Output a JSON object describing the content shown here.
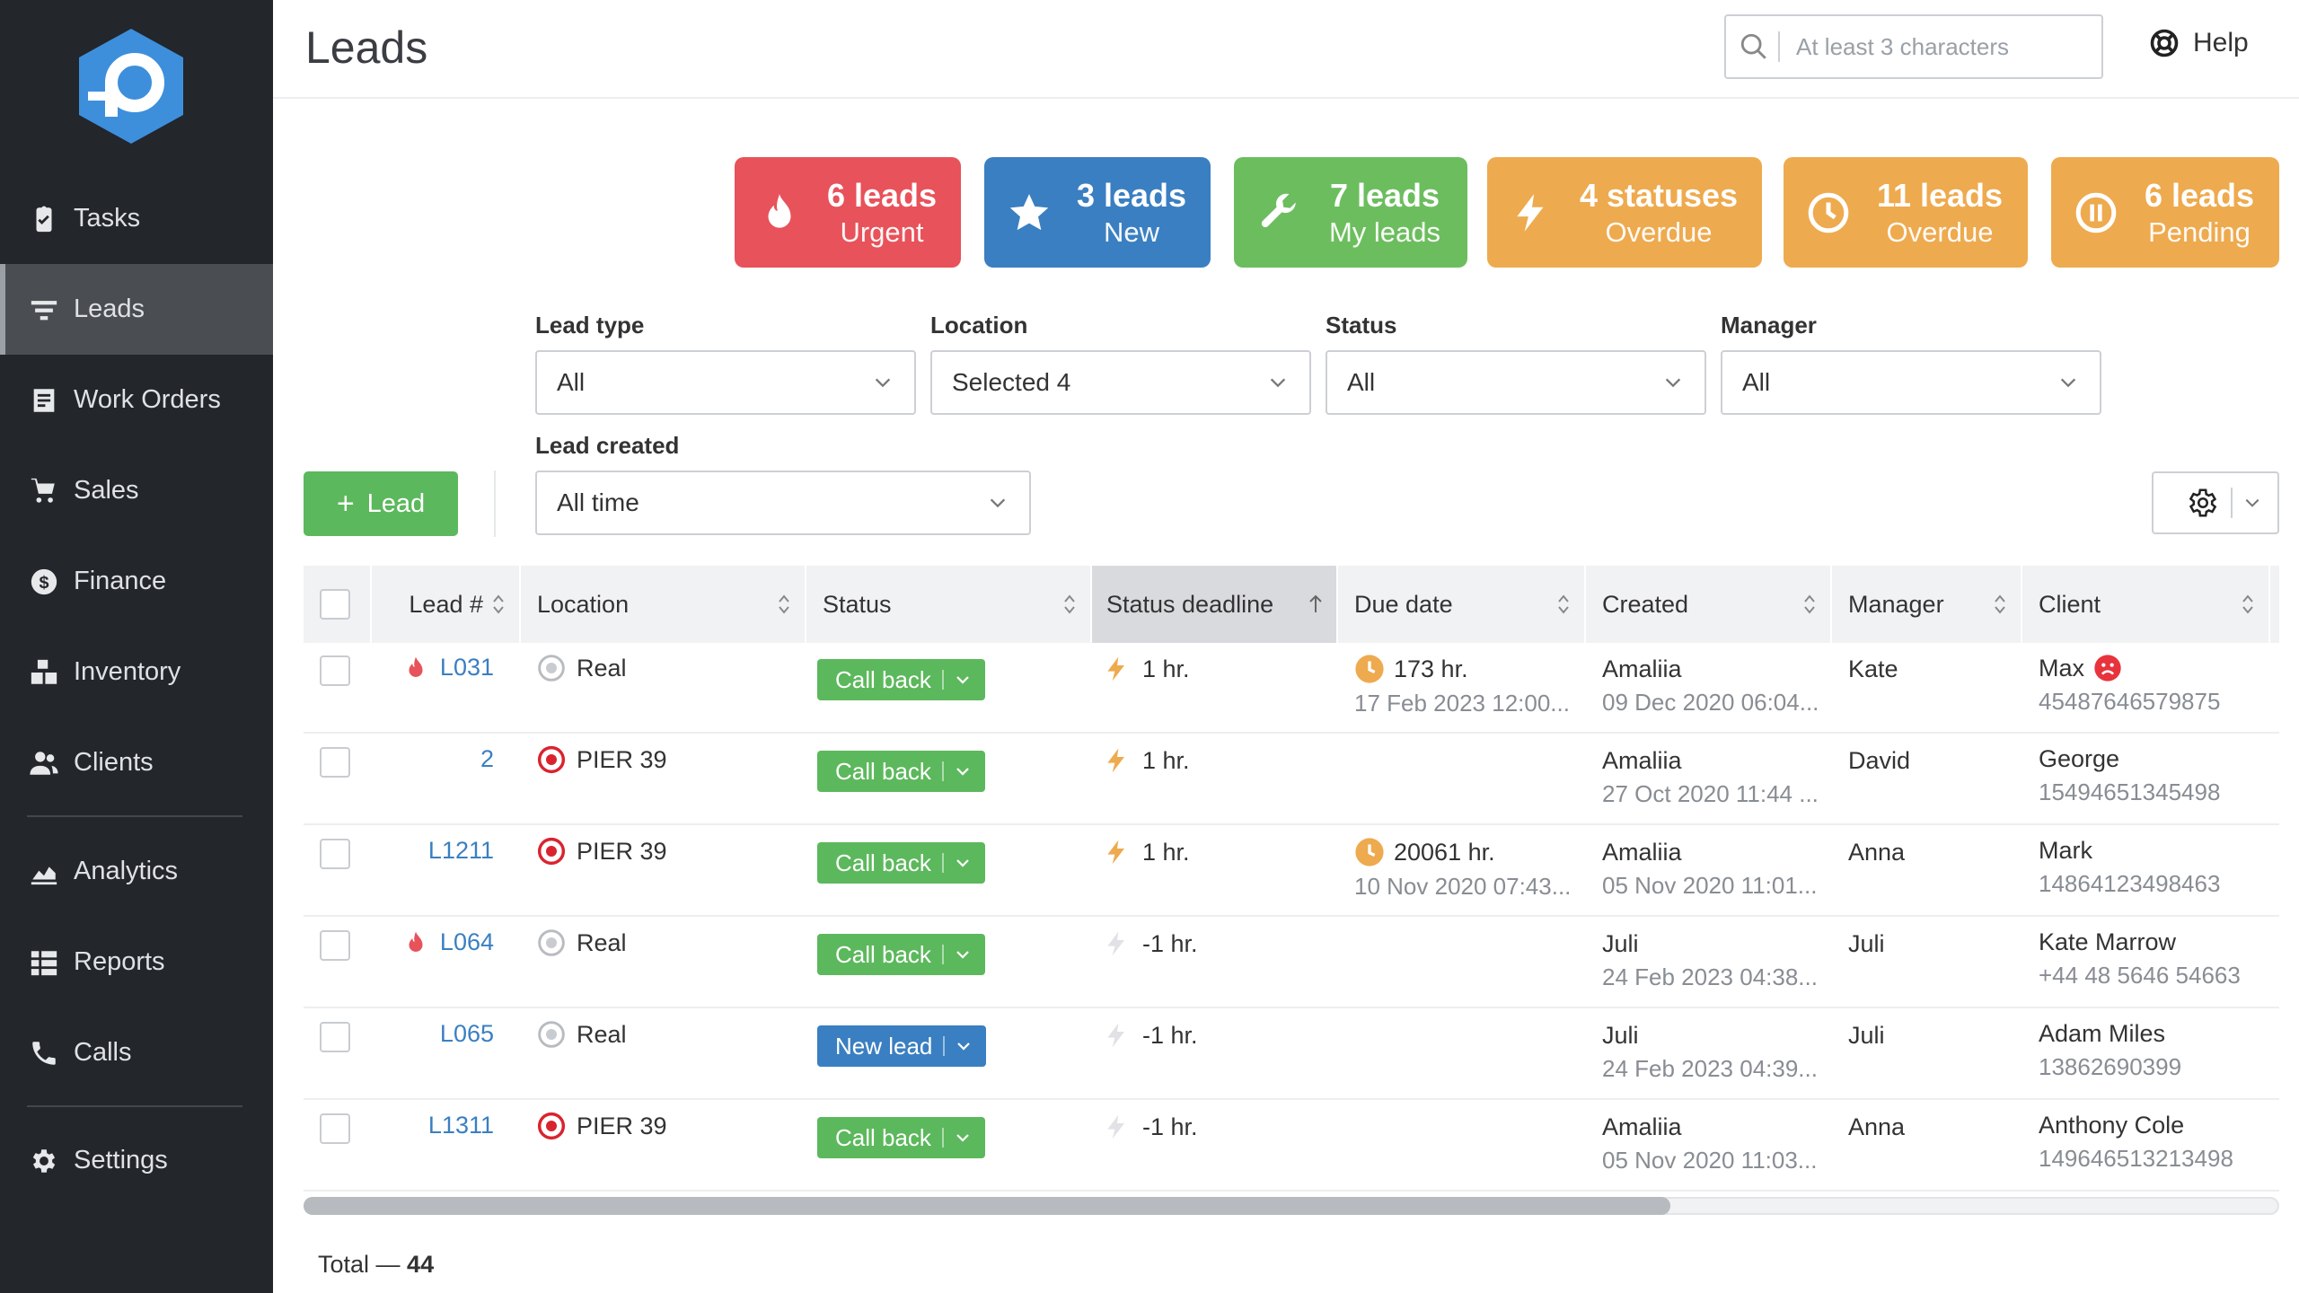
{
  "sidebar": {
    "items": [
      {
        "label": "Tasks",
        "icon": "clipboard-check-icon"
      },
      {
        "label": "Leads",
        "icon": "filter-icon",
        "active": true
      },
      {
        "label": "Work Orders",
        "icon": "document-icon"
      },
      {
        "label": "Sales",
        "icon": "cart-icon"
      },
      {
        "label": "Finance",
        "icon": "dollar-icon"
      },
      {
        "label": "Inventory",
        "icon": "boxes-icon"
      },
      {
        "label": "Clients",
        "icon": "users-icon"
      },
      {
        "label": "Analytics",
        "icon": "chart-icon"
      },
      {
        "label": "Reports",
        "icon": "reports-icon"
      },
      {
        "label": "Calls",
        "icon": "phone-icon"
      },
      {
        "label": "Settings",
        "icon": "gear-icon"
      }
    ]
  },
  "header": {
    "title": "Leads",
    "search_placeholder": "At least 3 characters",
    "help_label": "Help"
  },
  "summary_cards": [
    {
      "big": "6 leads",
      "small": "Urgent",
      "color": "#e8525a",
      "icon": "flame-icon"
    },
    {
      "big": "3 leads",
      "small": "New",
      "color": "#3a7fc1",
      "icon": "star-icon"
    },
    {
      "big": "7 leads",
      "small": "My leads",
      "color": "#6cbd5e",
      "icon": "wrench-icon"
    },
    {
      "big": "4 statuses",
      "small": "Overdue",
      "color": "#eeaa4e",
      "icon": "lightning-icon"
    },
    {
      "big": "11 leads",
      "small": "Overdue",
      "color": "#eeaa4e",
      "icon": "clock-icon"
    },
    {
      "big": "6 leads",
      "small": "Pending",
      "color": "#eeaa4e",
      "icon": "pause-icon"
    }
  ],
  "filters": {
    "lead_type": {
      "label": "Lead type",
      "value": "All"
    },
    "location": {
      "label": "Location",
      "value": "Selected 4"
    },
    "status": {
      "label": "Status",
      "value": "All"
    },
    "manager": {
      "label": "Manager",
      "value": "All"
    },
    "lead_created": {
      "label": "Lead created",
      "value": "All time"
    }
  },
  "toolbar": {
    "add_lead_label": "Lead"
  },
  "table": {
    "columns": [
      "Lead #",
      "Location",
      "Status",
      "Status deadline",
      "Due date",
      "Created",
      "Manager",
      "Client"
    ],
    "rows": [
      {
        "urgent": true,
        "lead": "L031",
        "loc_icon": "empty",
        "location": "Real",
        "status": "Call back",
        "status_color": "green",
        "deadline_active": true,
        "deadline": "1 hr.",
        "due": "173 hr.",
        "due_sub": "17 Feb 2023 12:00...",
        "created": "Amaliia",
        "created_sub": "09 Dec 2020 06:04...",
        "manager": "Kate",
        "client": "Max",
        "client_sub": "45487646579875",
        "client_sad": true
      },
      {
        "urgent": false,
        "lead": "2",
        "loc_icon": "target",
        "location": "PIER 39",
        "status": "Call back",
        "status_color": "green",
        "deadline_active": true,
        "deadline": "1 hr.",
        "due": "",
        "due_sub": "",
        "created": "Amaliia",
        "created_sub": "27 Oct 2020 11:44 ...",
        "manager": "David",
        "client": "George",
        "client_sub": "15494651345498",
        "client_sad": false
      },
      {
        "urgent": false,
        "lead": "L1211",
        "loc_icon": "target",
        "location": "PIER 39",
        "status": "Call back",
        "status_color": "green",
        "deadline_active": true,
        "deadline": "1 hr.",
        "due": "20061 hr.",
        "due_sub": "10 Nov 2020 07:43...",
        "created": "Amaliia",
        "created_sub": "05 Nov 2020 11:01...",
        "manager": "Anna",
        "client": "Mark",
        "client_sub": "14864123498463",
        "client_sad": false
      },
      {
        "urgent": true,
        "lead": "L064",
        "loc_icon": "empty",
        "location": "Real",
        "status": "Call back",
        "status_color": "green",
        "deadline_active": false,
        "deadline": "-1 hr.",
        "due": "",
        "due_sub": "",
        "created": "Juli",
        "created_sub": "24 Feb 2023 04:38...",
        "manager": "Juli",
        "client": "Kate Marrow",
        "client_sub": "+44 48 5646 54663",
        "client_sad": false
      },
      {
        "urgent": false,
        "lead": "L065",
        "loc_icon": "empty",
        "location": "Real",
        "status": "New lead",
        "status_color": "blue",
        "deadline_active": false,
        "deadline": "-1 hr.",
        "due": "",
        "due_sub": "",
        "created": "Juli",
        "created_sub": "24 Feb 2023 04:39...",
        "manager": "Juli",
        "client": "Adam Miles",
        "client_sub": "13862690399",
        "client_sad": false
      },
      {
        "urgent": false,
        "lead": "L1311",
        "loc_icon": "target",
        "location": "PIER 39",
        "status": "Call back",
        "status_color": "green",
        "deadline_active": false,
        "deadline": "-1 hr.",
        "due": "",
        "due_sub": "",
        "created": "Amaliia",
        "created_sub": "05 Nov 2020 11:03...",
        "manager": "Anna",
        "client": "Anthony Cole",
        "client_sub": "149646513213498",
        "client_sad": false
      }
    ]
  },
  "footer": {
    "total_label": "Total — ",
    "total_value": "44"
  },
  "colors": {
    "sidebar_bg": "#23262b",
    "accent_green": "#5cb85c",
    "link_blue": "#3a7fc1",
    "urgent_red": "#e8525a",
    "overdue_orange": "#eeaa4e"
  }
}
